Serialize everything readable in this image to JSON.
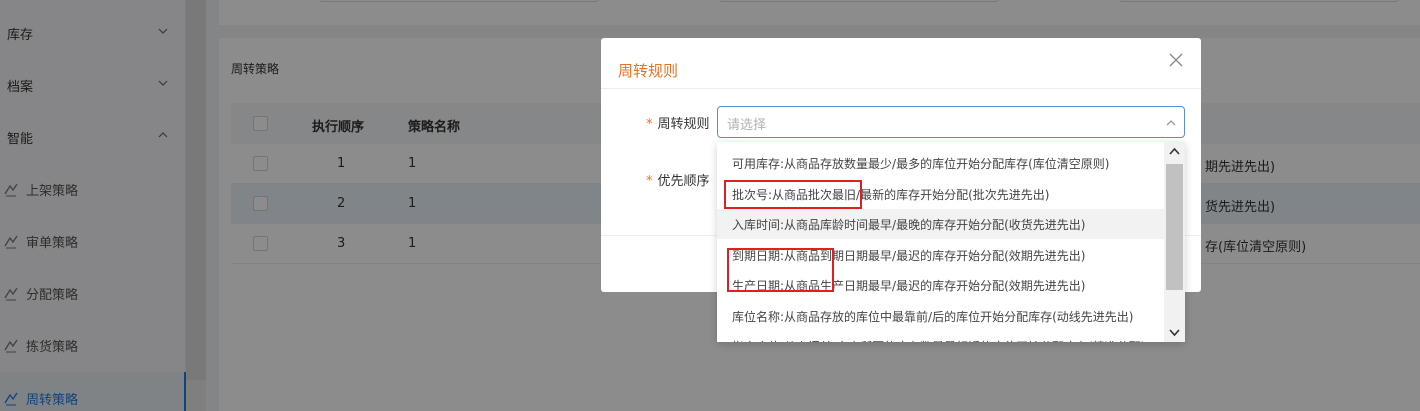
{
  "sidebar": {
    "groups": [
      {
        "label": "库存"
      },
      {
        "label": "档案"
      },
      {
        "label": "智能"
      }
    ],
    "items": [
      {
        "label": "上架策略"
      },
      {
        "label": "审单策略"
      },
      {
        "label": "分配策略"
      },
      {
        "label": "拣货策略"
      },
      {
        "label": "周转策略"
      }
    ]
  },
  "panel": {
    "title": "周转策略",
    "columns": [
      "执行顺序",
      "策略名称"
    ],
    "rows": [
      {
        "order": "1",
        "name": "1",
        "tail": "期先进先出)"
      },
      {
        "order": "2",
        "name": "1",
        "tail": "货先进先出)"
      },
      {
        "order": "3",
        "name": "1",
        "tail": "存(库位清空原则)"
      }
    ]
  },
  "dialog": {
    "title": "周转规则",
    "fields": [
      {
        "label": "周转规则",
        "placeholder": "请选择"
      },
      {
        "label": "优先顺序"
      }
    ],
    "options": [
      "可用库存:从商品存放数量最少/最多的库位开始分配库存(库位清空原则)",
      "批次号:从商品批次最旧/最新的库存开始分配(批次先进先出)",
      "入库时间:从商品库龄时间最早/最晚的库存开始分配(收货先进先出)",
      "到期日期:从商品到期日期最早/最迟的库存开始分配(效期先进先出)",
      "生产日期:从商品生产日期最早/最迟的库存开始分配(效期先进先出)",
      "库位名称:从商品存放的库位中最靠前/后的库位开始分配库存(动线先进先出)",
      "指定库位:从上门单/客户所要的库存数量最相近的库位开始分配库存(精准分配)"
    ]
  },
  "colors": {
    "accent": "#e8731f",
    "primary": "#1f7ae0",
    "annotation": "#e02020"
  }
}
